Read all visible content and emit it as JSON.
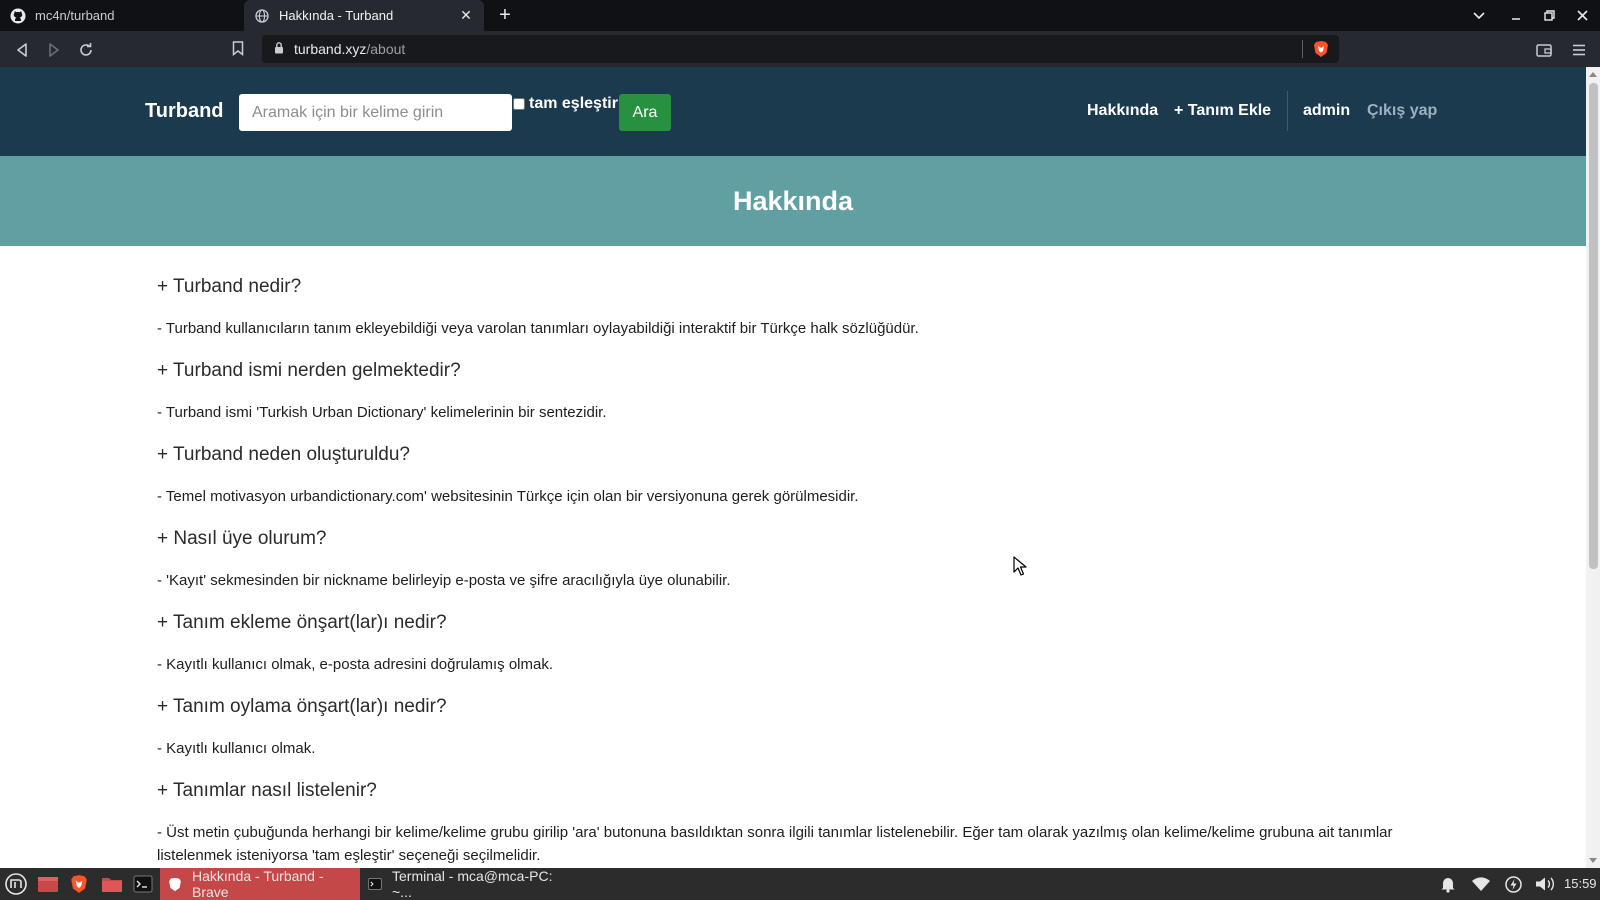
{
  "browser": {
    "tabs": [
      {
        "title": "mc4n/turband",
        "active": false,
        "icon": "github-icon"
      },
      {
        "title": "Hakkında - Turband",
        "active": true,
        "icon": "globe-icon"
      }
    ],
    "url_host": "turband.xyz",
    "url_path": "/about"
  },
  "navbar": {
    "brand": "Turband",
    "search_placeholder": "Aramak için bir kelime girin",
    "exact_match_label": "tam eşleştir",
    "search_button": "Ara",
    "links": {
      "about": "Hakkında",
      "add_definition": "+ Tanım Ekle",
      "user": "admin",
      "logout": "Çıkış yap"
    }
  },
  "hero": {
    "title": "Hakkında"
  },
  "faq": [
    {
      "q": "+ Turband nedir?",
      "a": "- Turband kullanıcıların tanım ekleyebildiği veya varolan tanımları oylayabildiği interaktif bir Türkçe halk sözlüğüdür."
    },
    {
      "q": "+ Turband ismi nerden gelmektedir?",
      "a": "- Turband ismi 'Turkish Urban Dictionary' kelimelerinin bir sentezidir."
    },
    {
      "q": "+ Turband neden oluşturuldu?",
      "a": "- Temel motivasyon urbandictionary.com' websitesinin Türkçe için olan bir versiyonuna gerek görülmesidir."
    },
    {
      "q": "+ Nasıl üye olurum?",
      "a": "- 'Kayıt' sekmesinden bir nickname belirleyip e-posta ve şifre aracılığıyla üye olunabilir."
    },
    {
      "q": "+ Tanım ekleme önşart(lar)ı nedir?",
      "a": "- Kayıtlı kullanıcı olmak, e-posta adresini doğrulamış olmak."
    },
    {
      "q": "+ Tanım oylama önşart(lar)ı nedir?",
      "a": "- Kayıtlı kullanıcı olmak."
    },
    {
      "q": "+ Tanımlar nasıl listelenir?",
      "a": "- Üst metin çubuğunda herhangi bir kelime/kelime grubu girilip 'ara' butonuna basıldıktan sonra ilgili tanımlar listelenebilir. Eğer tam olarak yazılmış olan kelime/kelime grubuna ait tanımlar listelenmek isteniyorsa 'tam eşleştir' seçeneği seçilmelidir."
    }
  ],
  "taskbar": {
    "windows": [
      {
        "title": "Hakkında - Turband - Brave",
        "active": true
      },
      {
        "title": "Terminal - mca@mca-PC: ~...",
        "active": false
      }
    ],
    "clock": "15:59"
  },
  "colors": {
    "navbar_bg": "#1b3a4e",
    "hero_bg": "#60a0a2",
    "search_button_bg": "#27913f",
    "active_taskbar": "#c44848"
  }
}
